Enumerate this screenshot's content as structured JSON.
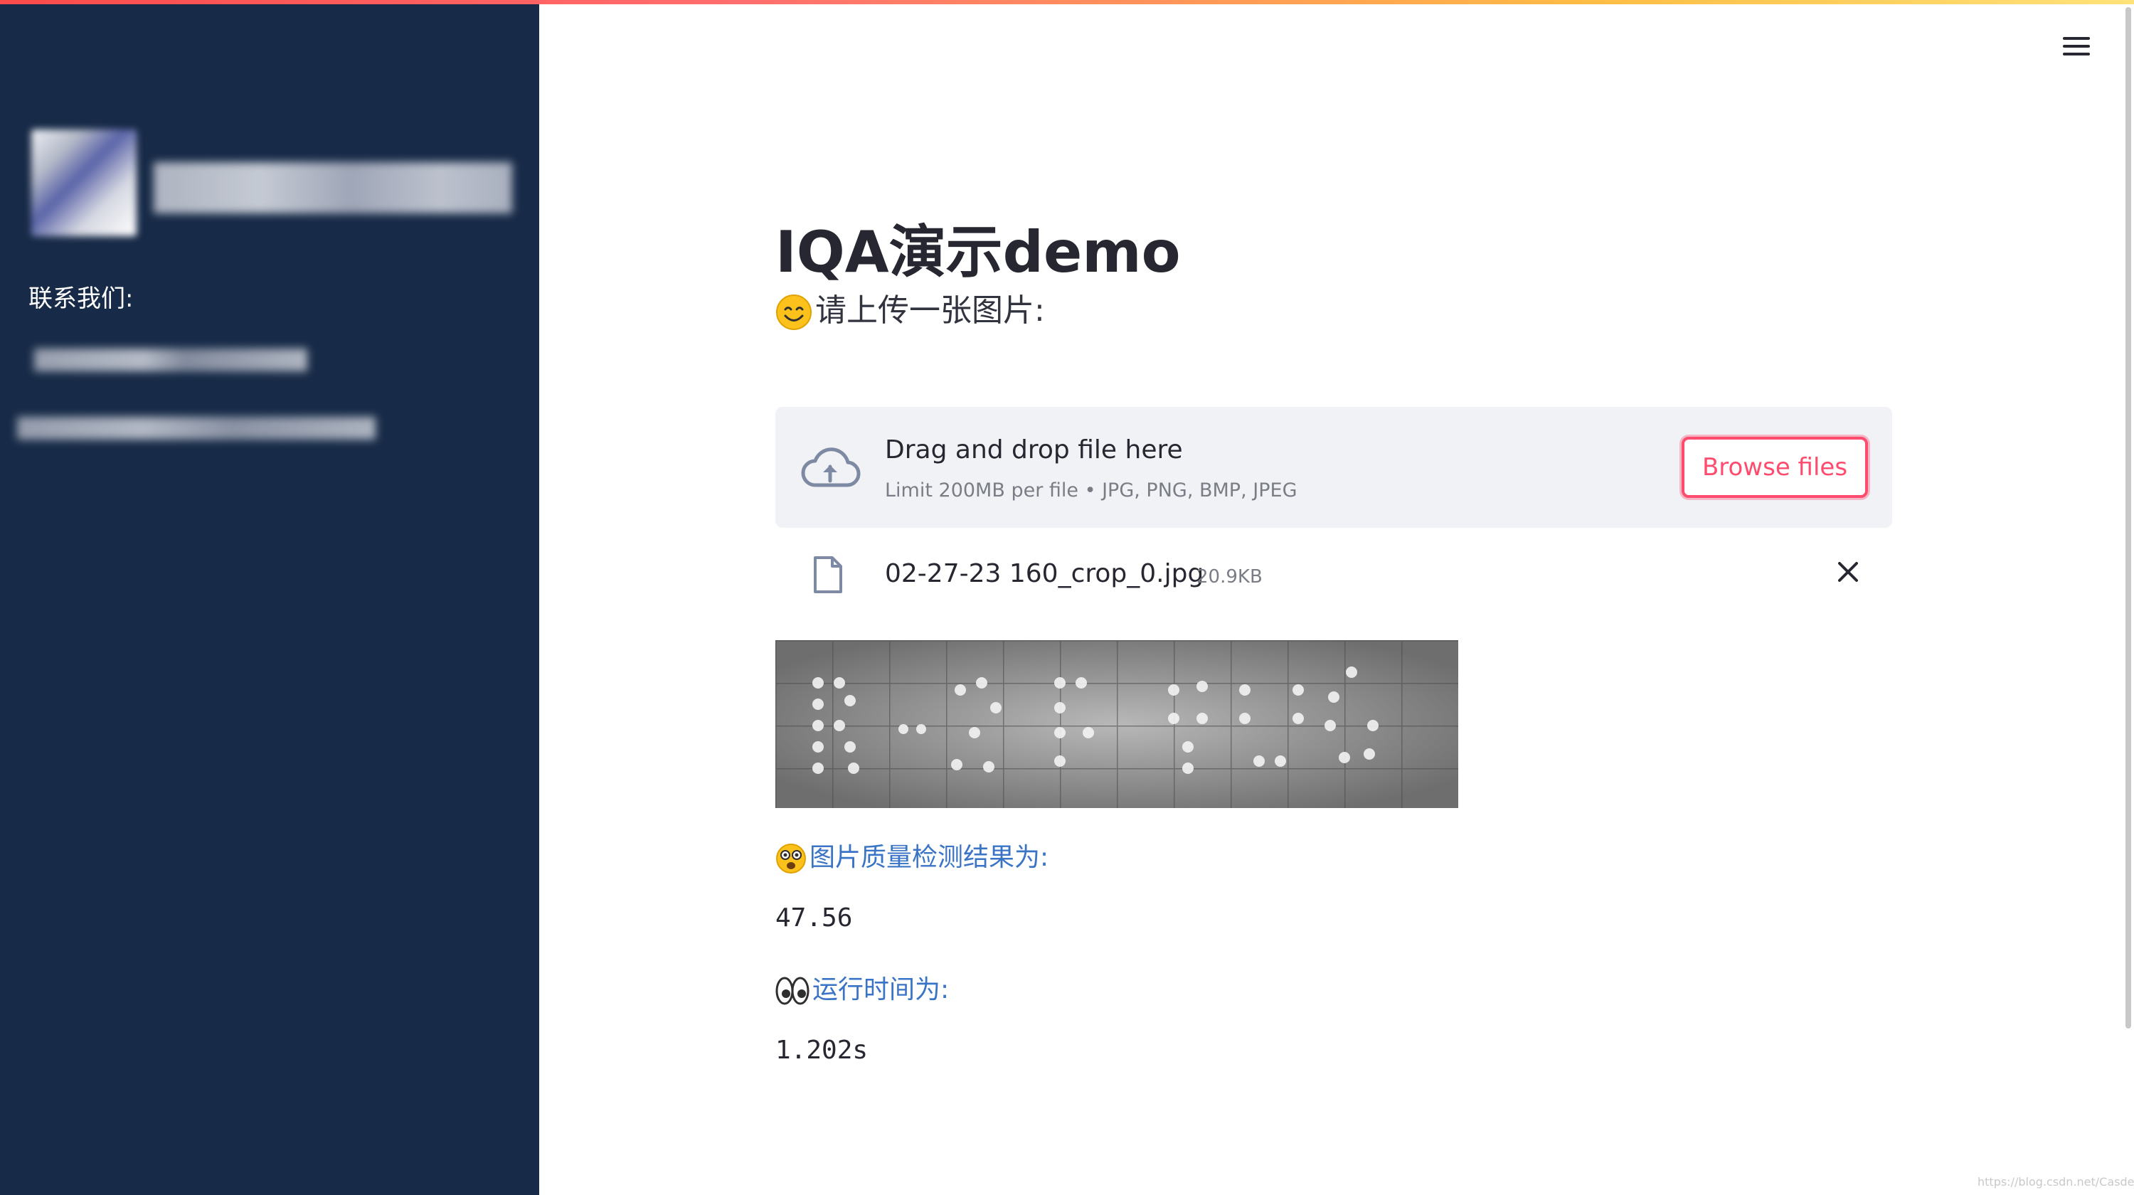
{
  "page": {
    "title": "IQA演示demo",
    "subtitle": "请上传一张图片:",
    "accent_color": "#ff4b6e",
    "link_color": "#3a74c6",
    "sidebar_color": "#172a47"
  },
  "sidebar": {
    "contact_label": "联系我们:"
  },
  "uploader": {
    "drag_text": "Drag and drop file here",
    "limit_text": "Limit 200MB per file • JPG, PNG, BMP, JPEG",
    "browse_label": "Browse files",
    "icon": "cloud-upload-icon"
  },
  "file": {
    "name": "02-27-23 160_crop_0.jpg",
    "size": "20.9KB",
    "icon": "file-icon"
  },
  "results": {
    "quality_label": "图片质量检测结果为:",
    "quality_value": "47.56",
    "time_label": "运行时间为:",
    "time_value": "1.202s"
  },
  "watermark": "https://blog.csdn.net/Casdelve"
}
